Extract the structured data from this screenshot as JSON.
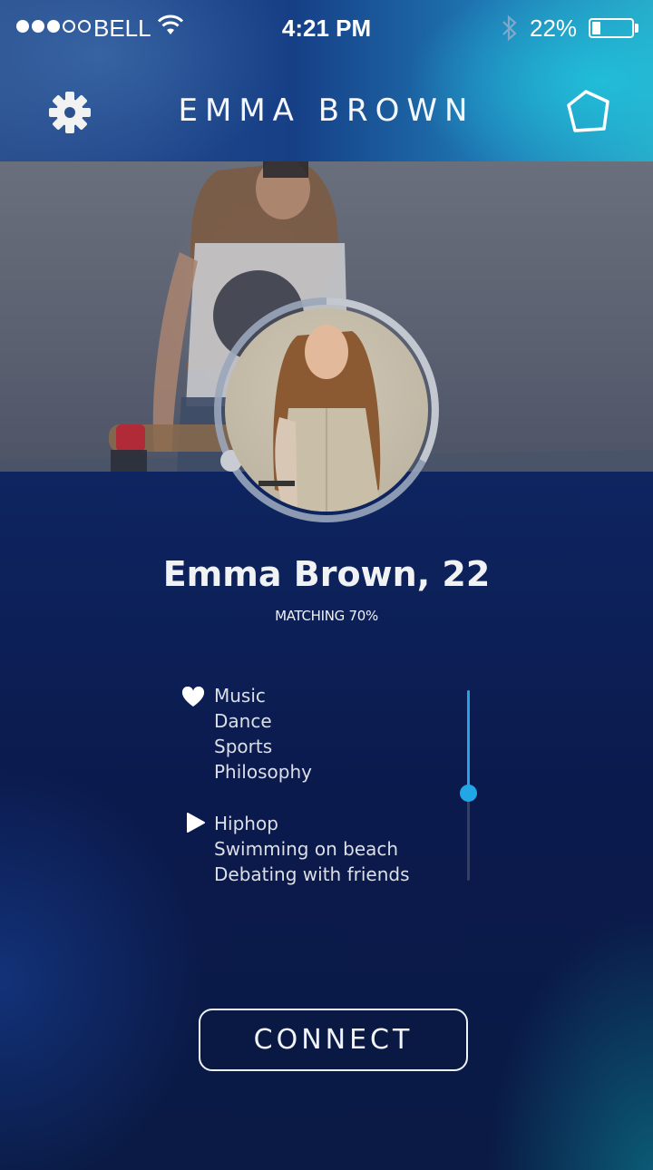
{
  "status_bar": {
    "signal_bars_filled": 3,
    "signal_bars_total": 5,
    "carrier": "BELL",
    "time": "4:21 PM",
    "battery_percent": "22%",
    "battery_level": 0.22,
    "icons": [
      "wifi-icon",
      "bluetooth-icon",
      "battery-icon"
    ]
  },
  "nav": {
    "title": "EMMA BROWN",
    "left_icon": "gear-icon",
    "right_icon": "pentagon-icon"
  },
  "profile": {
    "name_age": "Emma Brown, 22",
    "matching": "MATCHING 70%"
  },
  "interests": {
    "likes_icon": "heart-icon",
    "likes": [
      "Music",
      "Dance",
      "Sports",
      "Philosophy"
    ],
    "activities_icon": "play-icon",
    "activities": [
      "Hiphop",
      "Swimming on beach",
      "Debating with friends"
    ]
  },
  "slider": {
    "level": 0.55
  },
  "actions": {
    "connect_label": "CONNECT"
  },
  "colors": {
    "accent": "#22a7e6",
    "header_start": "#2b4f8f",
    "header_end": "#29a8c8",
    "background": "#0b1f55"
  }
}
